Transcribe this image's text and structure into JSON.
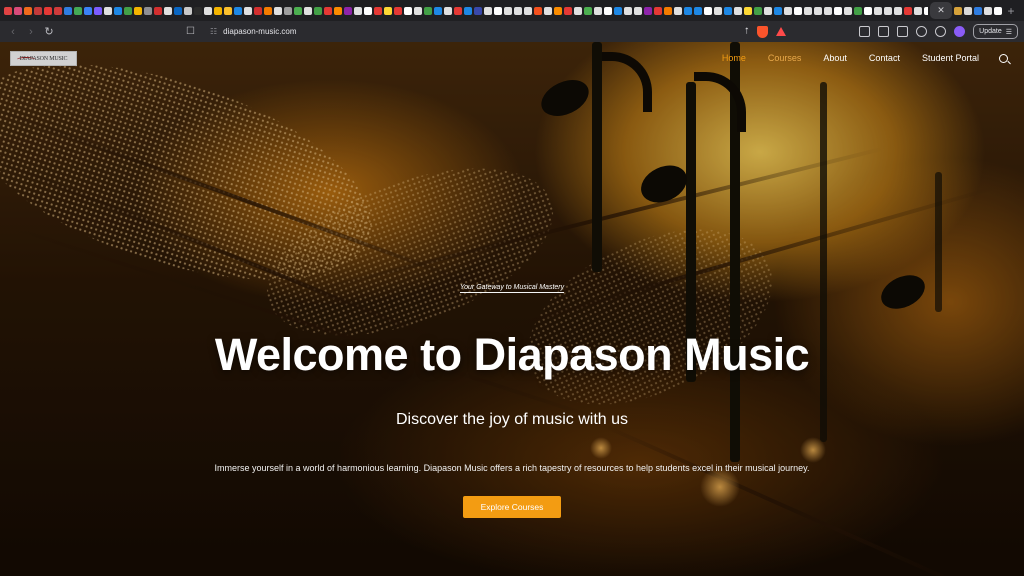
{
  "browser": {
    "url": "diapason-music.com",
    "update_label": "Update",
    "favicon_colors": [
      "#e04343",
      "#d84b7a",
      "#f06a1c",
      "#c43a3a",
      "#e53935",
      "#cf3b3b",
      "#2f7de1",
      "#44aa55",
      "#3b82f6",
      "#7c5cff",
      "#e0e0e0",
      "#1e88e5",
      "#43a047",
      "#f4b400",
      "#8e8e93",
      "#d32f2f",
      "#e0e0e0",
      "#0a66c2",
      "#c8c8c8",
      "#2b2b2b",
      "#e0e0e0",
      "#f4b400",
      "#fbc02d",
      "#1e88e5",
      "#e0e0e0",
      "#d32f2f",
      "#f57c00",
      "#e0e0e0",
      "#9e9e9e",
      "#4caf50",
      "#e0e0e0",
      "#43a047",
      "#e53935",
      "#fb8c00",
      "#8e24aa",
      "#e0e0e0",
      "#ffffff",
      "#e53935",
      "#fdd835",
      "#e53935",
      "#ffffff",
      "#e0e0e0",
      "#43a047",
      "#1e88e5",
      "#e0e0e0",
      "#e53935",
      "#1e88e5",
      "#3949ab",
      "#e0e0e0",
      "#ffffff",
      "#e0e0e0",
      "#e0e0e0",
      "#e0e0e0",
      "#f4511e",
      "#e0e0e0",
      "#fb8c00",
      "#e53935",
      "#e0e0e0",
      "#4caf50",
      "#e0e0e0",
      "#ffffff",
      "#1e88e5",
      "#e0e0e0",
      "#e0e0e0",
      "#8e24aa",
      "#e53935",
      "#f57c00",
      "#e0e0e0",
      "#1e88e5",
      "#1e88e5",
      "#ffffff",
      "#e0e0e0",
      "#1e88e5",
      "#e0e0e0",
      "#fdd835",
      "#43a047",
      "#e0e0e0",
      "#1e88e5",
      "#e0e0e0",
      "#ffffff",
      "#e0e0e0",
      "#e0e0e0",
      "#e0e0e0",
      "#ffffff",
      "#e0e0e0",
      "#43a047",
      "#ffffff",
      "#e0e0e0",
      "#e0e0e0",
      "#e0e0e0",
      "#e53935",
      "#e0e0e0",
      "#ffffff",
      "#e0e0e0",
      "#1e88e5",
      "#43a047",
      "#1e88e5",
      "#e0e0e0",
      "#ffffff",
      "#e0e0e0",
      "#e0e0e0",
      "#e0e0e0",
      "#f4b400",
      "#e0e0e0",
      "#e0e0e0",
      "#ffffff",
      "#ffffff",
      "#ffffff",
      "#ffffff"
    ]
  },
  "site": {
    "logo_text": "DIAPASON MUSIC",
    "nav": [
      {
        "label": "Home",
        "state": "active"
      },
      {
        "label": "Courses",
        "state": "dim"
      },
      {
        "label": "About",
        "state": "normal"
      },
      {
        "label": "Contact",
        "state": "normal"
      },
      {
        "label": "Student Portal",
        "state": "normal"
      }
    ],
    "accent_color": "#f39c12"
  },
  "hero": {
    "tagline": "Your Gateway to Musical Mastery",
    "headline": "Welcome to Diapason Music",
    "subheadline": "Discover the joy of music with us",
    "description": "Immerse yourself in a world of harmonious learning. Diapason Music offers a rich tapestry of resources to help students excel in their musical journey.",
    "cta_label": "Explore Courses"
  }
}
